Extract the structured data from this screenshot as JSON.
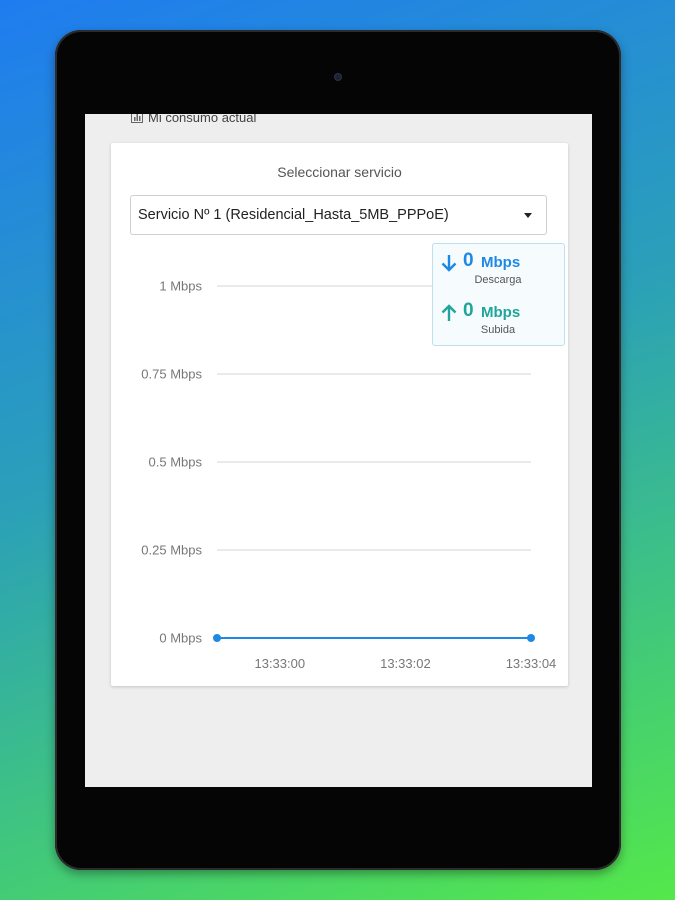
{
  "section_title": "Mi consumo actual",
  "select": {
    "label": "Seleccionar servicio",
    "value": "Servicio Nº 1 (Residencial_Hasta_5MB_PPPoE)"
  },
  "speed": {
    "download": {
      "value": "0",
      "unit": "Mbps",
      "label": "Descarga"
    },
    "upload": {
      "value": "0",
      "unit": "Mbps",
      "label": "Subida"
    }
  },
  "colors": {
    "download": "#1e88e5",
    "upload": "#1fa59a",
    "line": "#1e88e5"
  },
  "chart_data": {
    "type": "line",
    "y_ticks": [
      {
        "value": 0,
        "label": "0 Mbps"
      },
      {
        "value": 0.25,
        "label": "0.25 Mbps"
      },
      {
        "value": 0.5,
        "label": "0.5 Mbps"
      },
      {
        "value": 0.75,
        "label": "0.75 Mbps"
      },
      {
        "value": 1,
        "label": "1 Mbps"
      }
    ],
    "x_ticks": [
      "13:33:00",
      "13:33:02",
      "13:33:04"
    ],
    "ylim": [
      0,
      1
    ],
    "grid": true,
    "series": [
      {
        "points": [
          {
            "x": "13:32:59",
            "y": 0
          },
          {
            "x": "13:33:04",
            "y": 0
          }
        ]
      }
    ]
  }
}
